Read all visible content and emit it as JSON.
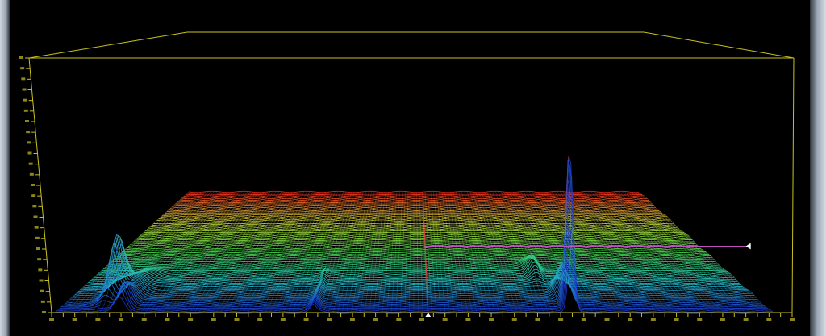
{
  "window": {
    "frame_color": "#aab4c0"
  },
  "chart_data": {
    "type": "surface",
    "title": "",
    "xlabel": "",
    "ylabel": "",
    "zlabel": "",
    "grid": false,
    "legend": "none",
    "colormap": [
      "#1a2fd0",
      "#26c2c8",
      "#44d04a",
      "#c8d43a",
      "#e8281c"
    ],
    "box_color": "#c8c020",
    "mesh_rows": 80,
    "mesh_cols": 160,
    "x_range": [
      0,
      1
    ],
    "y_range": [
      0,
      1
    ],
    "z_range": [
      0,
      1
    ],
    "peaks": [
      {
        "name": "",
        "x": 0.06,
        "y": 0.16,
        "height": 0.2
      },
      {
        "name": "",
        "x": 0.09,
        "y": 0.05,
        "height": 0.08
      },
      {
        "name": "",
        "x": 0.72,
        "y": 0.04,
        "height": 0.55
      },
      {
        "name": "",
        "x": 0.72,
        "y": 0.16,
        "height": 0.1
      },
      {
        "name": "",
        "x": 0.69,
        "y": 0.34,
        "height": 0.06
      },
      {
        "name": "",
        "x": 0.36,
        "y": 0.05,
        "height": 0.02
      }
    ],
    "cursor": {
      "x": 0.52,
      "y": 0.55
    }
  }
}
